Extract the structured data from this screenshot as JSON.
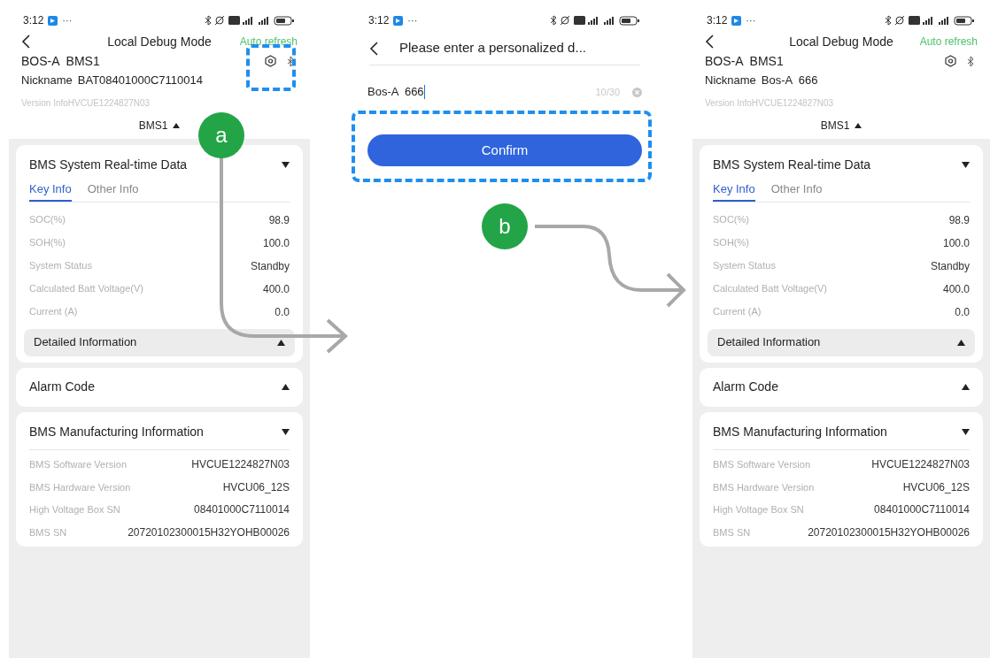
{
  "screens": [
    {
      "kind": "device",
      "status_time": "3:12",
      "status_more": "···",
      "title": "Local Debug Mode",
      "auto_refresh": "Auto refresh",
      "device_name": "BOS-A  BMS1",
      "nickname_label": "Nickname",
      "nickname": "BAT08401000C7110014",
      "version": "Version InfoHVCUE1224827N03",
      "module": "BMS1",
      "sections": [
        {
          "kind": "realtime",
          "title": "BMS System Real-time Data",
          "expanded": true,
          "tabs": [
            {
              "label": "Key Info",
              "selected": true
            },
            {
              "label": "Other Info",
              "selected": false
            }
          ],
          "rows": [
            {
              "label": "SOC(%)",
              "value": "98.9"
            },
            {
              "label": "SOH(%)",
              "value": "100.0"
            },
            {
              "label": "System Status",
              "value": "Standby"
            },
            {
              "label": "Calculated Batt Voltage(V)",
              "value": "400.0"
            },
            {
              "label": "Current (A)",
              "value": "0.0"
            }
          ],
          "subsection": {
            "title": "Detailed Information",
            "expanded": false
          }
        },
        {
          "kind": "plain",
          "title": "Alarm Code",
          "expanded": false
        },
        {
          "kind": "info",
          "title": "BMS Manufacturing Information",
          "expanded": true,
          "rows": [
            {
              "label": "BMS Software Version",
              "value": "HVCUE1224827N03"
            },
            {
              "label": "BMS Hardware Version",
              "value": "HVCU06_12S"
            },
            {
              "label": "High Voltage Box SN",
              "value": "08401000C7110014"
            },
            {
              "label": "BMS SN",
              "value": "20720102300015H32YOHB00026"
            }
          ]
        }
      ]
    },
    {
      "kind": "edit",
      "status_time": "3:12",
      "status_more": "···",
      "title": "Please enter a personalized d...",
      "value": "Bos-A  666",
      "counter": "10/30",
      "button": "Confirm"
    },
    {
      "kind": "device",
      "status_time": "3:12",
      "status_more": "···",
      "title": "Local Debug Mode",
      "auto_refresh": "Auto refresh",
      "device_name": "BOS-A  BMS1",
      "nickname_label": "Nickname",
      "nickname": "Bos-A  666",
      "version": "Version InfoHVCUE1224827N03",
      "module": "BMS1",
      "sections": [
        {
          "kind": "realtime",
          "title": "BMS System Real-time Data",
          "expanded": true,
          "tabs": [
            {
              "label": "Key Info",
              "selected": true
            },
            {
              "label": "Other Info",
              "selected": false
            }
          ],
          "rows": [
            {
              "label": "SOC(%)",
              "value": "98.9"
            },
            {
              "label": "SOH(%)",
              "value": "100.0"
            },
            {
              "label": "System Status",
              "value": "Standby"
            },
            {
              "label": "Calculated Batt Voltage(V)",
              "value": "400.0"
            },
            {
              "label": "Current (A)",
              "value": "0.0"
            }
          ],
          "subsection": {
            "title": "Detailed Information",
            "expanded": false
          }
        },
        {
          "kind": "plain",
          "title": "Alarm Code",
          "expanded": false
        },
        {
          "kind": "info",
          "title": "BMS Manufacturing Information",
          "expanded": true,
          "rows": [
            {
              "label": "BMS Software Version",
              "value": "HVCUE1224827N03"
            },
            {
              "label": "BMS Hardware Version",
              "value": "HVCU06_12S"
            },
            {
              "label": "High Voltage Box SN",
              "value": "08401000C7110014"
            },
            {
              "label": "BMS SN",
              "value": "20720102300015H32YOHB00026"
            }
          ]
        }
      ]
    }
  ],
  "markers": [
    {
      "label": "a"
    },
    {
      "label": "b"
    }
  ]
}
